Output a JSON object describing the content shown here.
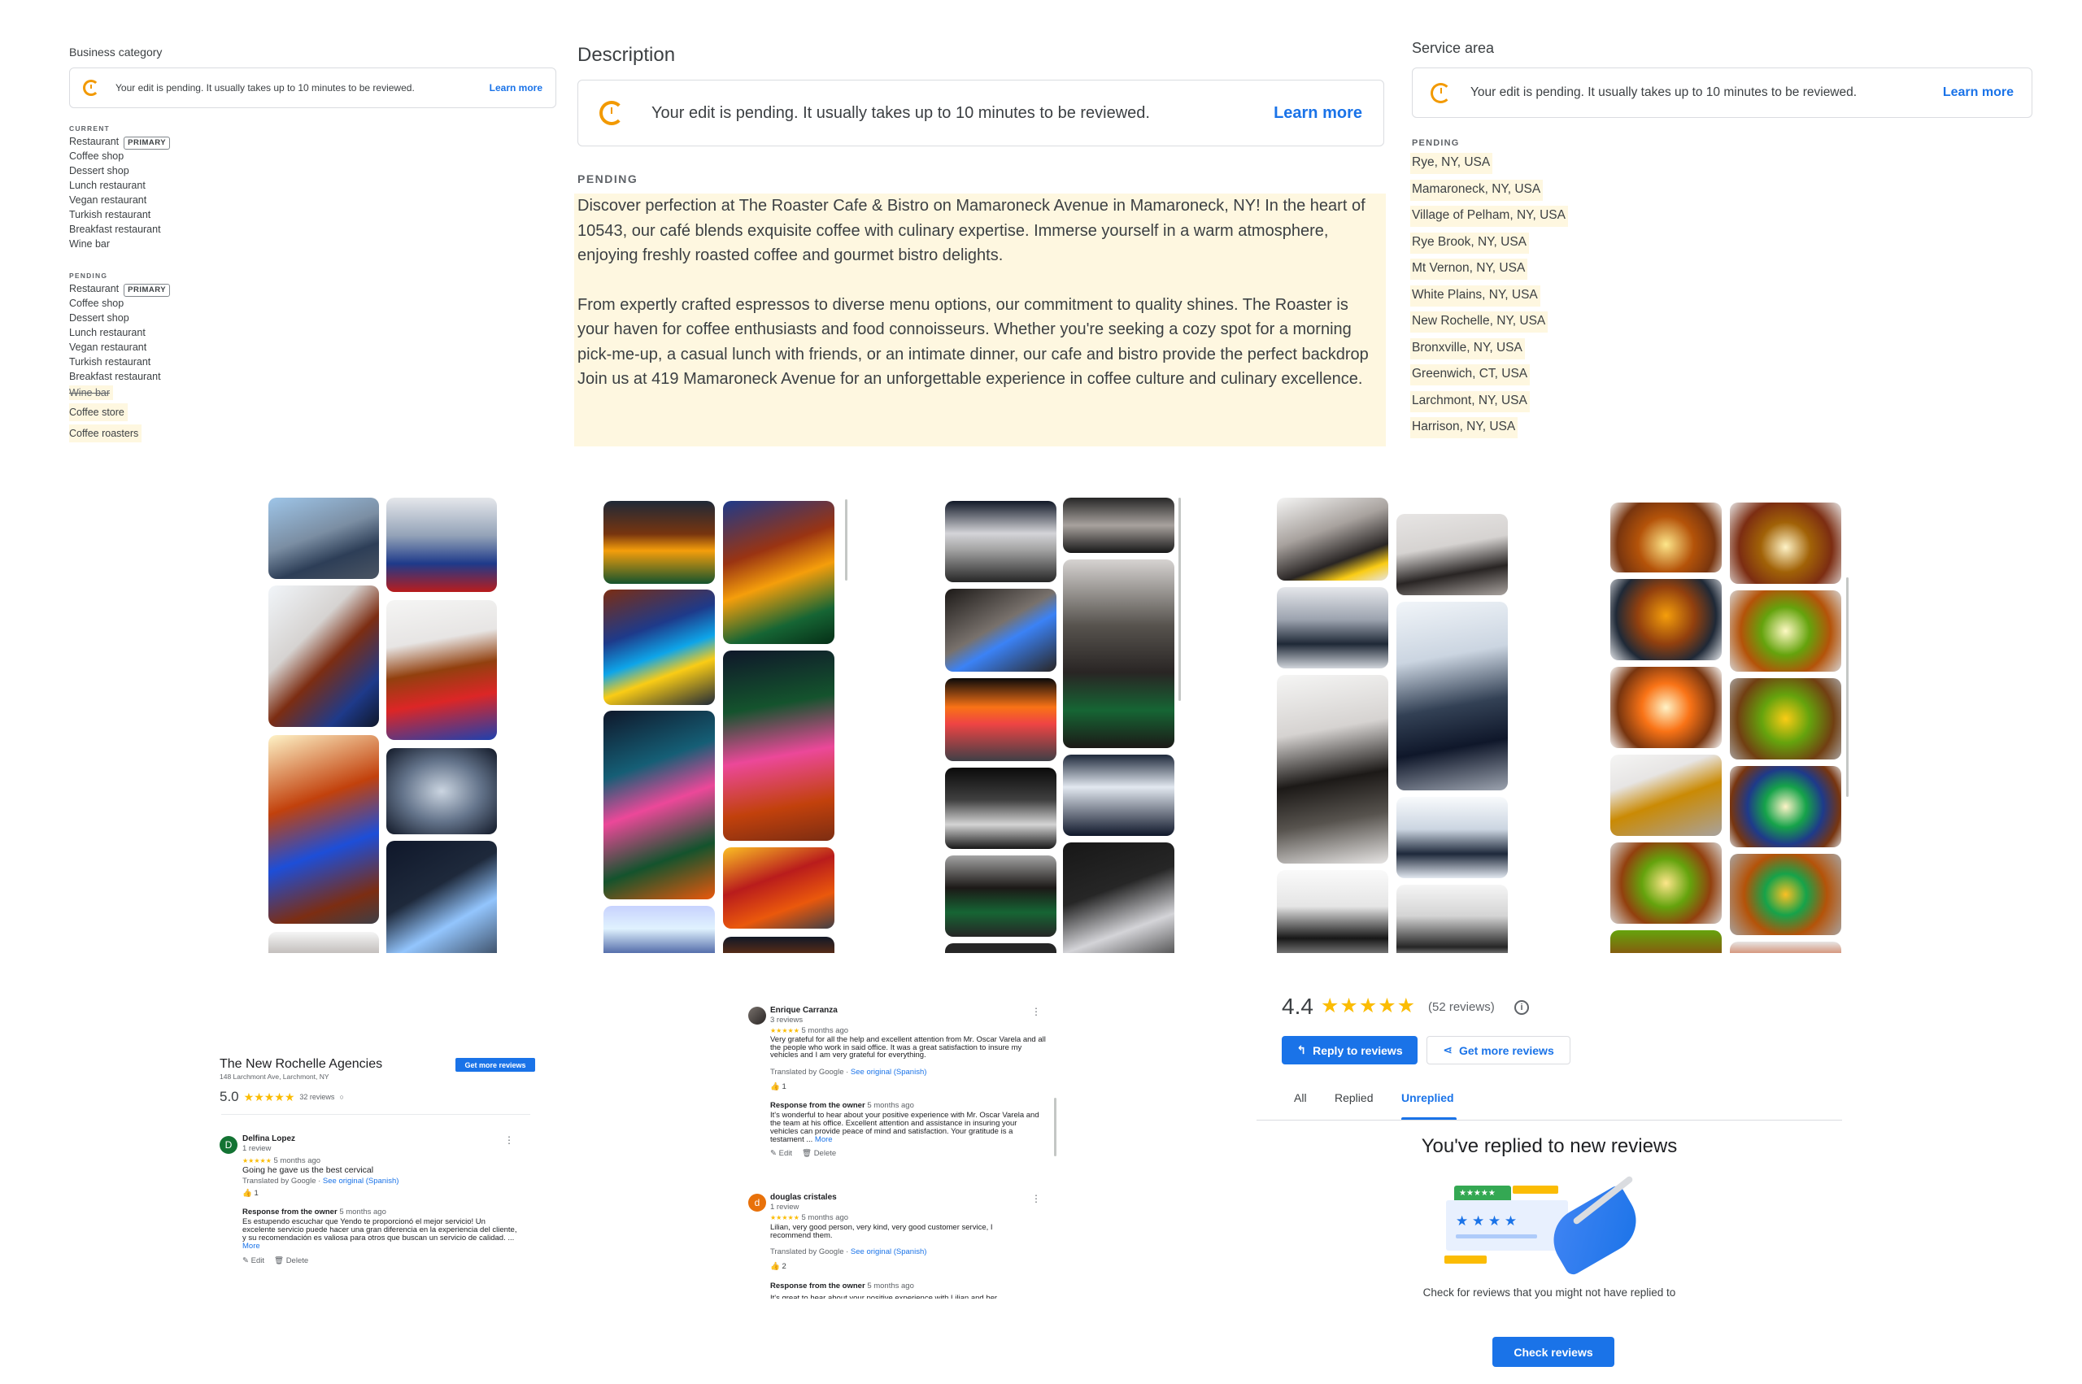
{
  "business_category": {
    "title": "Business category",
    "notice": "Your edit is pending. It usually takes up to 10 minutes to be reviewed.",
    "learn_more": "Learn more",
    "current_label": "CURRENT",
    "current": [
      "Restaurant",
      "Coffee shop",
      "Dessert shop",
      "Lunch restaurant",
      "Vegan restaurant",
      "Turkish restaurant",
      "Breakfast restaurant",
      "Wine bar"
    ],
    "primary_badge": "PRIMARY",
    "pending_label": "PENDING",
    "pending": [
      "Restaurant",
      "Coffee shop",
      "Dessert shop",
      "Lunch restaurant",
      "Vegan restaurant",
      "Turkish restaurant",
      "Breakfast restaurant"
    ],
    "removed": "Wine bar",
    "added": [
      "Coffee store",
      "Coffee roasters"
    ]
  },
  "description": {
    "title": "Description",
    "notice": "Your edit is pending. It usually takes up to 10 minutes to be reviewed.",
    "learn_more": "Learn more",
    "pending_label": "PENDING",
    "para1": "Discover perfection at The Roaster Cafe & Bistro on Mamaroneck Avenue in Mamaroneck, NY! In the heart of 10543, our café blends exquisite coffee with culinary expertise. Immerse yourself in a warm atmosphere, enjoying freshly roasted coffee and gourmet bistro delights.",
    "para2": "From expertly crafted espressos to diverse menu options, our commitment to quality shines. The Roaster is your haven for coffee enthusiasts and food connoisseurs. Whether you're seeking a cozy spot for a morning pick-me-up, a casual lunch with friends, or an intimate dinner, our cafe and bistro provide the perfect backdrop",
    "para3": "Join us at 419 Mamaroneck Avenue for an unforgettable experience in coffee culture and culinary excellence."
  },
  "service_area": {
    "title": "Service area",
    "notice": "Your edit is pending. It usually takes up to 10 minutes to be reviewed.",
    "learn_more": "Learn more",
    "pending_label": "PENDING",
    "areas": [
      "Rye, NY, USA",
      "Mamaroneck, NY, USA",
      "Village of Pelham, NY, USA",
      "Rye Brook, NY, USA",
      "Mt Vernon, NY, USA",
      "White Plains, NY, USA",
      "New Rochelle, NY, USA",
      "Bronxville, NY, USA",
      "Greenwich, CT, USA",
      "Larchmont, NY, USA",
      "Harrison, NY, USA"
    ]
  },
  "review_card_1": {
    "business": "The New Rochelle Agencies",
    "address": "148 Larchmont Ave, Larchmont, NY",
    "get_more": "Get more reviews",
    "rating": "5.0",
    "stars": "★★★★★",
    "count": "32 reviews",
    "reviewer": "Delfina Lopez",
    "reviewer_initial": "D",
    "reviewer_meta": "1 review",
    "time": "5 months ago",
    "text": "Going he gave us the best cervical",
    "translated": "Translated by Google ·",
    "see_original": "See original (Spanish)",
    "likes": "1",
    "response_label": "Response from the owner",
    "response_time": "5 months ago",
    "response_text": "Es estupendo escuchar que Yendo te proporcionó el mejor servicio! Un excelente servicio puede hacer una gran diferencia en la experiencia del cliente, y su recomendación es valiosa para otros que buscan un servicio de calidad. ...",
    "more": "More",
    "edit": "Edit",
    "delete": "Delete"
  },
  "review_card_2": {
    "reviewer1": "Enrique Carranza",
    "reviewer1_meta": "3 reviews",
    "time1": "5 months ago",
    "text1": "Very grateful for all the help and excellent attention from Mr. Oscar Varela and all the people who work in said office. It was a great satisfaction to insure my vehicles and I am very grateful for everything.",
    "translated": "Translated by Google ·",
    "see_original": "See original (Spanish)",
    "likes1": "1",
    "response_label": "Response from the owner",
    "response_time1": "5 months ago",
    "response_text1": "It's wonderful to hear about your positive experience with Mr. Oscar Varela and the team at his office. Excellent attention and assistance in insuring your vehicles can provide peace of mind and satisfaction. Your gratitude is a testament ...",
    "more": "More",
    "edit": "Edit",
    "delete": "Delete",
    "reviewer2": "douglas cristales",
    "reviewer2_initial": "d",
    "reviewer2_meta": "1 review",
    "time2": "5 months ago",
    "text2": "Lilian, very good person, very kind, very good customer service, I recommend them.",
    "likes2": "2",
    "response_time2": "5 months ago",
    "response_text2": "It's great to hear about your positive experience with Lilian and her"
  },
  "reviews_panel": {
    "rating": "4.4",
    "stars": "★★★★★",
    "count": "(52 reviews)",
    "reply_btn": "Reply to reviews",
    "get_more_btn": "Get more reviews",
    "tabs": [
      "All",
      "Replied",
      "Unreplied"
    ],
    "heading": "You've replied to new reviews",
    "sub": "Check for reviews that you might not have replied to",
    "check_btn": "Check reviews",
    "illus_stars": "★ ★ ★ ★"
  },
  "colors": {
    "accent": "#1a73e8",
    "pending_highlight": "#fef7e0",
    "pending_icon": "#f29900",
    "star": "#fbbc04"
  }
}
